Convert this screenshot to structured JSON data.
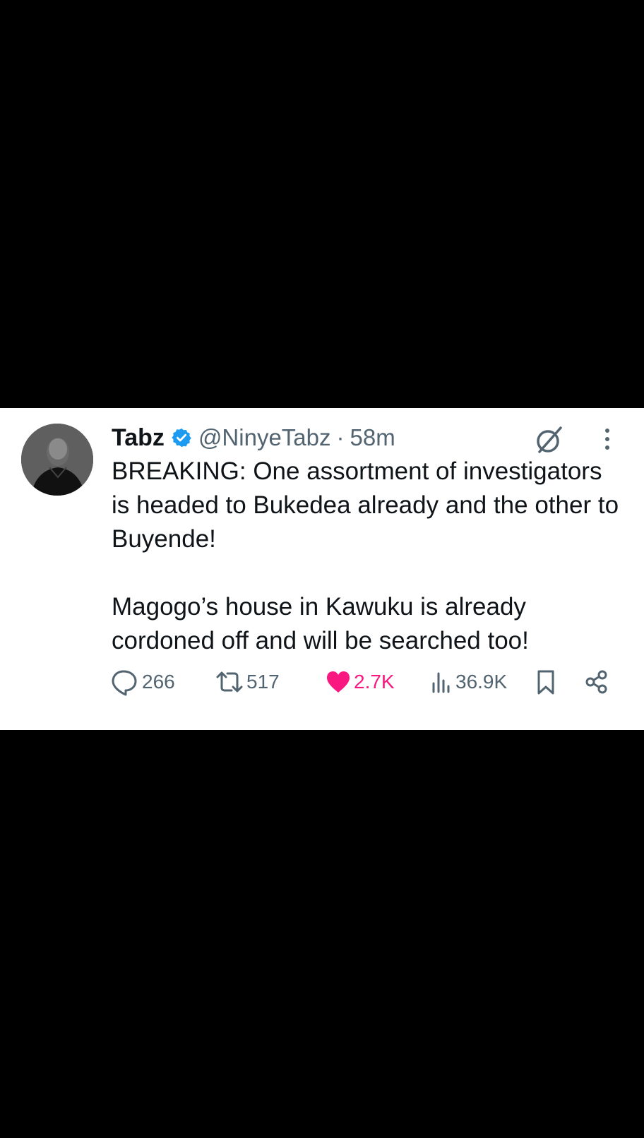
{
  "tweet": {
    "author": {
      "display_name": "Tabz",
      "verified": true,
      "handle": "@NinyeTabz",
      "separator": "·",
      "time": "58m"
    },
    "paragraphs": [
      "BREAKING: One assortment of investigators is headed to Bukedea already and the other to Buyende!",
      "Magogo’s house in Kawuku is already cordoned off and will be searched too!"
    ],
    "actions": {
      "replies": "266",
      "reposts": "517",
      "likes": "2.7K",
      "views": "36.9K"
    },
    "liked": true
  },
  "colors": {
    "background": "#000000",
    "card": "#ffffff",
    "text": "#0f1419",
    "secondary": "#536471",
    "verified_blue": "#1d9bf0",
    "like_pink": "#f91880"
  },
  "icons": [
    "verified-badge-icon",
    "grok-icon",
    "more-options-icon",
    "reply-icon",
    "repost-icon",
    "like-icon",
    "views-icon",
    "bookmark-icon",
    "share-icon"
  ]
}
